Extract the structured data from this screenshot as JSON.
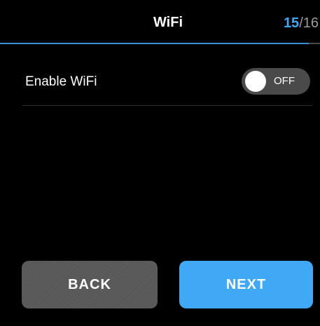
{
  "header": {
    "title": "WiFi",
    "page_current": "15",
    "page_separator": "/",
    "page_total": "16"
  },
  "setting": {
    "label": "Enable WiFi",
    "toggle_state": "OFF",
    "toggle_on": false
  },
  "buttons": {
    "back_label": "BACK",
    "next_label": "NEXT"
  },
  "colors": {
    "accent": "#3fa9f5",
    "background": "#000000",
    "secondary_button": "#575757",
    "toggle_off": "#4a4a4a"
  }
}
